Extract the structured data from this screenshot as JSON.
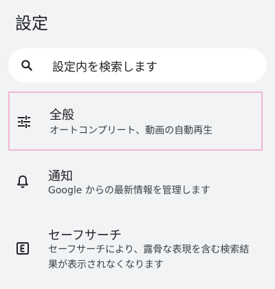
{
  "header": {
    "title": "設定"
  },
  "search": {
    "placeholder": "設定内を検索します",
    "icon": "search-icon"
  },
  "settings": [
    {
      "id": "general",
      "icon": "tune-sliders-icon",
      "title": "全般",
      "subtitle": "オートコンプリート、動画の自動再生",
      "selected": true
    },
    {
      "id": "notifications",
      "icon": "bell-icon",
      "title": "通知",
      "subtitle": "Google からの最新情報を管理します",
      "selected": false
    },
    {
      "id": "safesearch",
      "icon": "explicit-e-icon",
      "title": "セーフサーチ",
      "subtitle": "セーフサーチにより、露骨な表現を含む検索結果が表示されなくなります",
      "selected": false
    }
  ],
  "colors": {
    "background": "#f1f3f4",
    "selection_border": "#f4b6cf",
    "text_primary": "#202124",
    "text_secondary": "#3c4043"
  }
}
